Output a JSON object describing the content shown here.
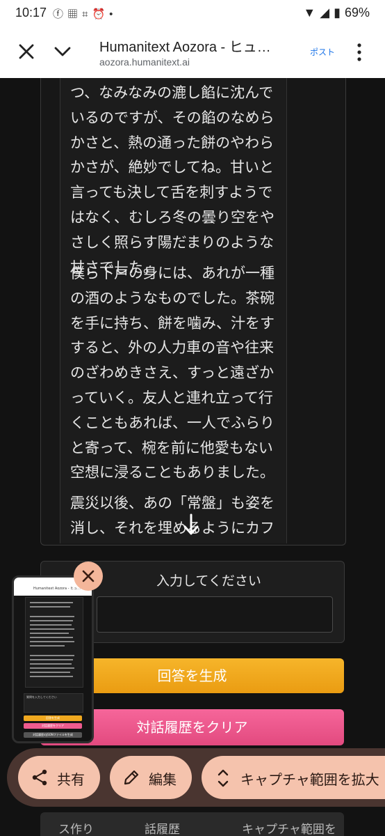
{
  "status_bar": {
    "time": "10:17",
    "battery": "69%",
    "left_icons": [
      "facebook-icon",
      "news-icon",
      "crop-icon",
      "alarm-icon",
      "dot-icon"
    ],
    "right_icons": [
      "wifi-icon",
      "signal-icon",
      "battery-icon"
    ]
  },
  "browser": {
    "title": "Humanitext Aozora - ヒュ…",
    "url": "aozora.humanitext.ai",
    "post_label": "ポスト"
  },
  "article": {
    "paragraphs": [
      "つ、なみなみの漉し餡に沈んでいるのですが、その餡のなめらかさと、熱の通った餅のやわらかさが、絶妙でしてね。甘いと言っても決して舌を刺すようではなく、むしろ冬の曇り空をやさしく照らす陽だまりのような甘さでした。",
      "僕ら下戸の身には、あれが一種の酒のようなものでした。茶碗を手に持ち、餅を噛み、汁をすすると、外の人力車の音や往来のざわめきさえ、すっと遠ざかっていく。友人と連れ立って行くこともあれば、一人でふらりと寄って、椀を前に他愛もない空想に浸ることもありました。",
      "震災以後、あの「常盤」も姿を消し、それを埋めるようにカフェが"
    ]
  },
  "input": {
    "label": "入力してください"
  },
  "buttons": {
    "generate": "回答を生成",
    "clear": "対話履歴をクリア"
  },
  "bottom_peek": {
    "left": "ス作り",
    "mid": "話履歴",
    "right": "キャプチャ範囲を拡"
  },
  "action_bar": {
    "share": "共有",
    "edit": "編集",
    "expand": "キャプチャ範囲を拡大"
  },
  "thumbnail": {
    "title": "Humanitext Aozora - ヒュ…",
    "input_label": "質問を入力してください",
    "btn1": "回答を生成",
    "btn2": "対話履歴をクリア",
    "btn3": "対話履歴のJSONファイルを生成"
  },
  "colors": {
    "generate_button": "#f0a81f",
    "clear_button": "#ee5b8e",
    "pill": "#f5c3ad",
    "action_bar": "#4a3530",
    "link": "#1a73e8"
  }
}
